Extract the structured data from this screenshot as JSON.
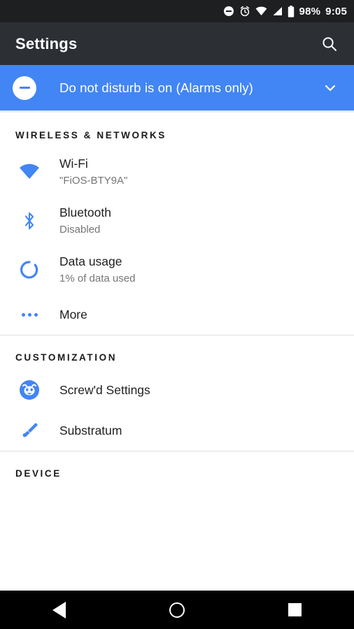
{
  "status_bar": {
    "icons": [
      "do-not-disturb-icon",
      "alarm-icon",
      "wifi-icon",
      "cellular-signal-icon",
      "battery-icon"
    ],
    "battery_percent": "98%",
    "time": "9:05",
    "background_color": "#1d1f21"
  },
  "app_bar": {
    "title": "Settings",
    "search_icon": "search-icon",
    "background_color": "#2c3034"
  },
  "dnd_banner": {
    "icon": "do-not-disturb-icon",
    "text": "Do not disturb is on (Alarms only)",
    "expand_icon": "chevron-down-icon",
    "background_color": "#4285f4"
  },
  "accent_color": "#4285f4",
  "sections": [
    {
      "header": "WIRELESS & NETWORKS",
      "items": [
        {
          "icon": "wifi-icon",
          "title": "Wi-Fi",
          "subtitle": "\"FiOS-BTY9A\""
        },
        {
          "icon": "bluetooth-icon",
          "title": "Bluetooth",
          "subtitle": "Disabled"
        },
        {
          "icon": "data-usage-icon",
          "title": "Data usage",
          "subtitle": "1% of data used"
        },
        {
          "icon": "more-dots-icon",
          "title": "More",
          "subtitle": ""
        }
      ]
    },
    {
      "header": "CUSTOMIZATION",
      "items": [
        {
          "icon": "screwd-logo-icon",
          "title": "Screw'd Settings",
          "subtitle": ""
        },
        {
          "icon": "paintbrush-icon",
          "title": "Substratum",
          "subtitle": ""
        }
      ]
    },
    {
      "header": "DEVICE",
      "items": []
    }
  ],
  "nav_bar": {
    "back": "back-triangle-icon",
    "home": "home-circle-icon",
    "recents": "recents-square-icon",
    "background_color": "#000000"
  }
}
